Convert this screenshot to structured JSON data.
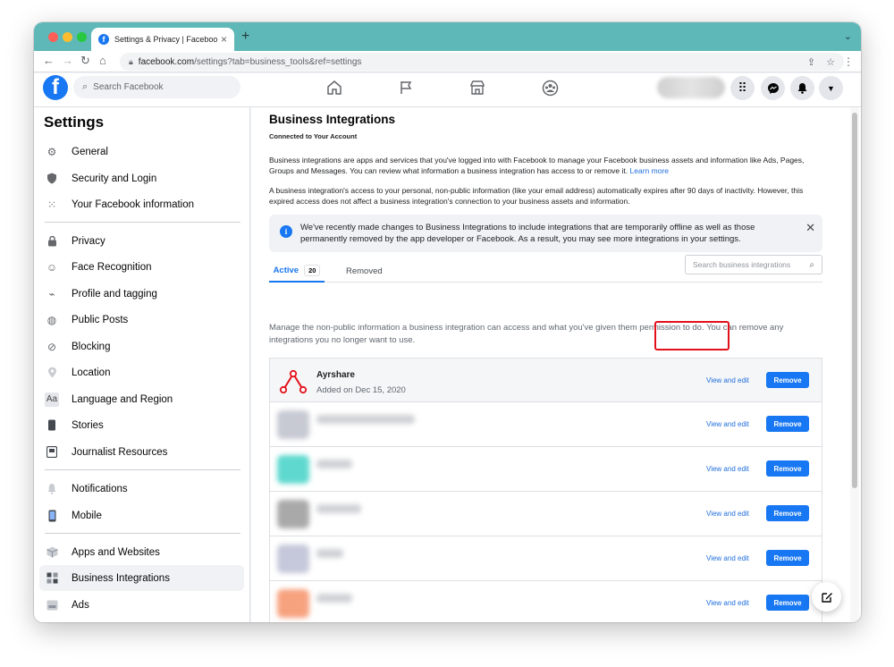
{
  "browser": {
    "tab_title": "Settings & Privacy | Facebook",
    "url_host": "facebook.com",
    "url_path": "/settings?tab=business_tools&ref=settings"
  },
  "fb_header": {
    "search_placeholder": "Search Facebook"
  },
  "sidebar": {
    "title": "Settings",
    "groups": [
      {
        "items": [
          {
            "label": "General",
            "icon": "gear-icon"
          },
          {
            "label": "Security and Login",
            "icon": "shield-icon"
          },
          {
            "label": "Your Facebook information",
            "icon": "grid-icon"
          }
        ]
      },
      {
        "items": [
          {
            "label": "Privacy",
            "icon": "lock-icon"
          },
          {
            "label": "Face Recognition",
            "icon": "face-icon"
          },
          {
            "label": "Profile and tagging",
            "icon": "tag-icon"
          },
          {
            "label": "Public Posts",
            "icon": "globe-icon"
          },
          {
            "label": "Blocking",
            "icon": "block-user-icon"
          },
          {
            "label": "Location",
            "icon": "pin-icon"
          },
          {
            "label": "Language and Region",
            "icon": "language-icon"
          },
          {
            "label": "Stories",
            "icon": "stories-icon"
          },
          {
            "label": "Journalist Resources",
            "icon": "badge-icon"
          }
        ]
      },
      {
        "items": [
          {
            "label": "Notifications",
            "icon": "bell-icon"
          },
          {
            "label": "Mobile",
            "icon": "phone-icon"
          }
        ]
      },
      {
        "items": [
          {
            "label": "Apps and Websites",
            "icon": "box-icon"
          },
          {
            "label": "Business Integrations",
            "icon": "business-icon"
          },
          {
            "label": "Ads",
            "icon": "ads-icon"
          }
        ]
      }
    ]
  },
  "main": {
    "title": "Business Integrations",
    "subtitle": "Connected to Your Account",
    "intro": "Business integrations are apps and services that you've logged into with Facebook to manage your Facebook business assets and information like Ads, Pages, Groups and Messages. You can review what information a business integration has access to or remove it.",
    "learn_more": "Learn more",
    "expiry_note": "A business integration's access to your personal, non-public information (like your email address) automatically expires after 90 days of inactivity. However, this expired access does not affect a business integration's connection to your business assets and information.",
    "banner": "We've recently made changes to Business Integrations to include integrations that are temporarily offline as well as those permanently removed by the app developer or Facebook. As a result, you may see more integrations in your settings.",
    "tabs": {
      "active": "Active",
      "active_count": "20",
      "removed": "Removed"
    },
    "search_placeholder": "Search business integrations",
    "manage_text": "Manage the non-public information a business integration can access and what you've given them permission to do. You can remove any integrations you no longer want to use.",
    "integrations": [
      {
        "name": "Ayrshare",
        "added": "Added on Dec 15, 2020",
        "view": "View and edit",
        "remove": "Remove",
        "logo_color": "#e3101a"
      },
      {
        "name": "",
        "added": "",
        "view": "View and edit",
        "remove": "Remove",
        "logo_color": "#c7c9d3"
      },
      {
        "name": "",
        "added": "",
        "view": "View and edit",
        "remove": "Remove",
        "logo_color": "#5fd9cf"
      },
      {
        "name": "",
        "added": "",
        "view": "View and edit",
        "remove": "Remove",
        "logo_color": "#a9a9a9"
      },
      {
        "name": "",
        "added": "",
        "view": "View and edit",
        "remove": "Remove",
        "logo_color": "#c5c8da"
      },
      {
        "name": "",
        "added": "",
        "view": "View and edit",
        "remove": "Remove",
        "logo_color": "#f7a27f"
      }
    ]
  },
  "colors": {
    "accent": "#1877f2",
    "highlight": "#e3101a",
    "tabstrip": "#5fb8b8"
  }
}
